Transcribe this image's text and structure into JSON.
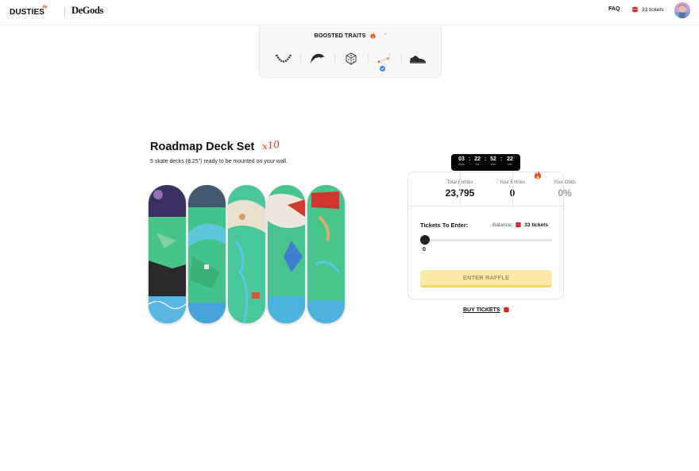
{
  "header": {
    "brand_primary": "DUSTIES",
    "brand_primary_sup": "by",
    "brand_secondary": "DeGods",
    "faq_label": "FAQ",
    "tickets_label": "33 tickets"
  },
  "traits": {
    "title": "BOOSTED TRAITS",
    "caret": "^",
    "items": [
      {
        "name": "chain-trait-icon"
      },
      {
        "name": "hair-trait-icon"
      },
      {
        "name": "dice-trait-icon"
      },
      {
        "name": "cigarette-trait-icon",
        "selected": true
      },
      {
        "name": "shoe-trait-icon"
      }
    ]
  },
  "product": {
    "title": "Roadmap Deck Set",
    "multiplier": "x10",
    "description": "5 skate decks (8.25\") ready to be mounted on your wall."
  },
  "timer": {
    "days": "03",
    "days_label": "days",
    "hrs": "22",
    "hrs_label": "hrs",
    "min": "52",
    "min_label": "min",
    "sec": "22",
    "sec_label": "sec"
  },
  "raffle": {
    "total_entries_label": "Total Entries",
    "total_entries": "23,795",
    "your_entries_label": "Your Entries",
    "your_entries": "0",
    "your_odds_label": "Your Odds",
    "your_odds": "0%",
    "tickets_to_enter_label": "Tickets To Enter:",
    "balance_label": "Balance:",
    "balance_value": "33 tickets",
    "slider_value": "0",
    "enter_button": "ENTER RAFFLE"
  },
  "buy_tickets": "BUY TICKETS",
  "colors": {
    "accent_red": "#e4321b",
    "button_yellow": "#fde9a6",
    "deck_green": "#3fbf7a"
  }
}
